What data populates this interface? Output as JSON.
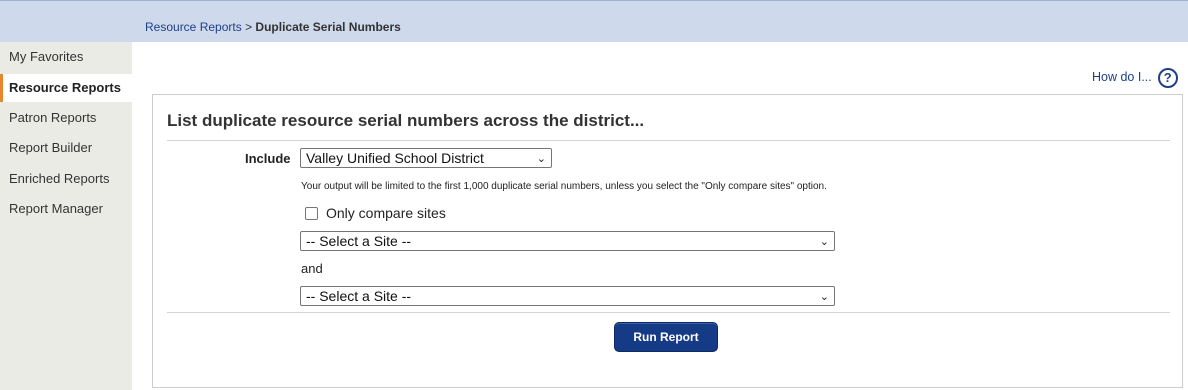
{
  "breadcrumb": {
    "parent": "Resource Reports",
    "separator": ">",
    "current": "Duplicate Serial Numbers"
  },
  "sidebar": {
    "items": [
      {
        "label": "My Favorites",
        "active": false
      },
      {
        "label": "Resource Reports",
        "active": true
      },
      {
        "label": "Patron Reports",
        "active": false
      },
      {
        "label": "Report Builder",
        "active": false
      },
      {
        "label": "Enriched Reports",
        "active": false
      },
      {
        "label": "Report Manager",
        "active": false
      }
    ]
  },
  "help": {
    "link_label": "How do I...",
    "icon": "question-circle-icon",
    "icon_glyph": "?"
  },
  "form": {
    "title": "List duplicate resource serial numbers across the district...",
    "include_label": "Include",
    "include_value": "Valley Unified School District",
    "note": "Your output will be limited to the first 1,000 duplicate serial numbers, unless you select the \"Only compare sites\" option.",
    "only_compare_label": "Only compare sites",
    "only_compare_checked": false,
    "site1_value": "-- Select a Site --",
    "and_label": "and",
    "site2_value": "-- Select a Site --",
    "run_label": "Run Report"
  },
  "colors": {
    "header_bg": "#cfd9ec",
    "sidebar_bg": "#ebebe6",
    "active_accent": "#e8862d",
    "link": "#1f3f87",
    "button_bg": "#163b86"
  }
}
